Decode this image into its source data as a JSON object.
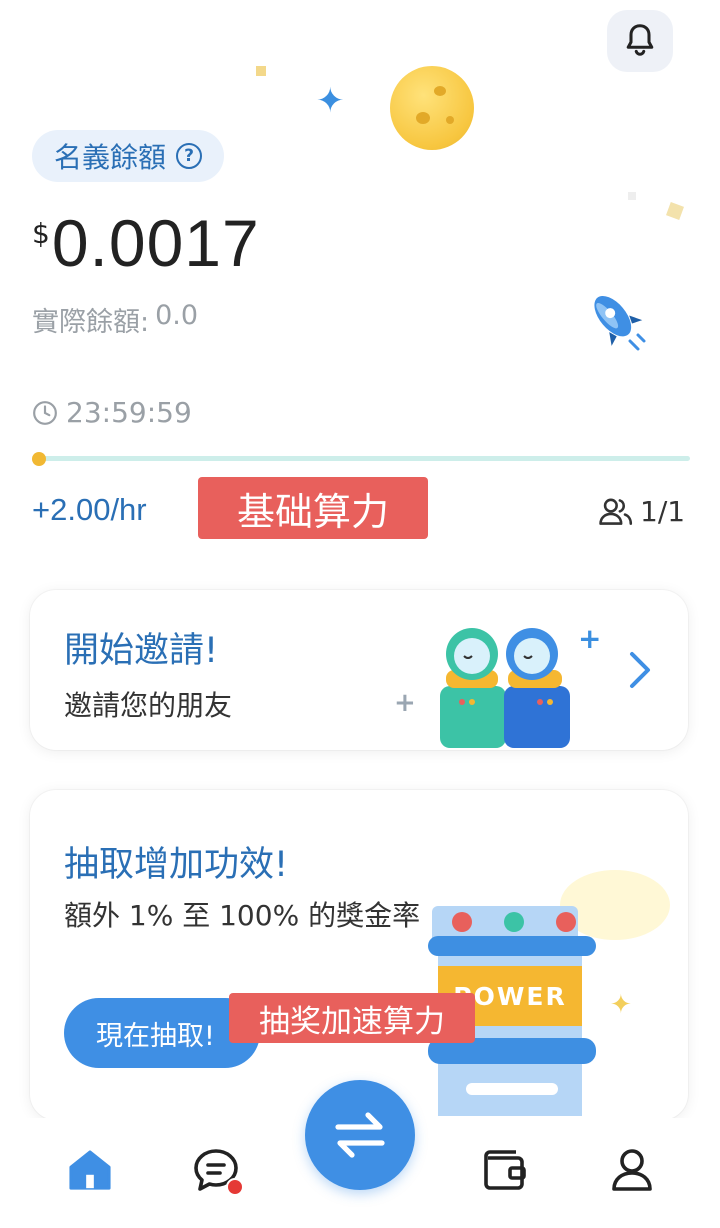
{
  "header": {
    "balance_label": "名義餘額",
    "help_icon_text": "?",
    "currency_symbol": "$",
    "balance_value": "0.0017",
    "actual_label": "實際餘額:",
    "actual_value": "0.0"
  },
  "mining": {
    "timer": "23:59:59",
    "rate": "+2.00/hr",
    "team_count": "1/1",
    "progress_fraction": 0.0
  },
  "annotations": {
    "base_power": "基础算力",
    "lottery_power": "抽奖加速算力"
  },
  "invite_card": {
    "title": "開始邀請!",
    "subtitle": "邀請您的朋友",
    "plus_a": "+",
    "plus_b": "+"
  },
  "boost_card": {
    "title": "抽取增加功效!",
    "subtitle": "額外 1% 至 100% 的獎金率",
    "button_label": "現在抽取!",
    "machine_label": "POWER"
  },
  "nav": {
    "items": [
      "home",
      "chat",
      "swap",
      "wallet",
      "profile"
    ],
    "chat_has_badge": true
  },
  "colors": {
    "accent": "#3f8fe4",
    "title_blue": "#2a6fb5",
    "annotation_red": "#e8605c",
    "progress": "#cdeeea"
  }
}
